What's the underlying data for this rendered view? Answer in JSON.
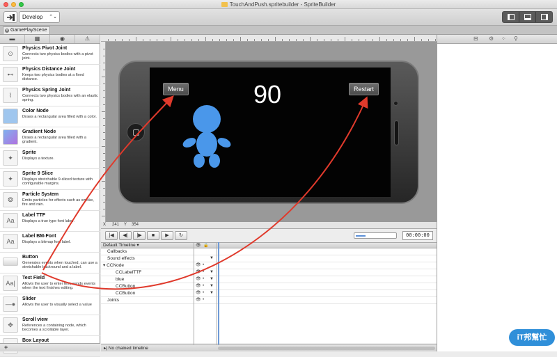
{
  "window": {
    "title": "TouchAndPush.spritebuilder - SpriteBuilder"
  },
  "toolbar": {
    "config": "Develop"
  },
  "tab": {
    "label": "GamePlayScene"
  },
  "library": {
    "items": [
      {
        "name": "Physics Pivot Joint",
        "desc": "Connects two physics bodies with a pivot joint.",
        "icon": "pivot-joint-icon",
        "glyph": "⊙"
      },
      {
        "name": "Physics Distance Joint",
        "desc": "Keeps two physics bodies at a fixed distance.",
        "icon": "distance-joint-icon",
        "glyph": "⊷"
      },
      {
        "name": "Physics Spring Joint",
        "desc": "Connects two physics bodies with an elastic spring.",
        "icon": "spring-joint-icon",
        "glyph": "⌇"
      },
      {
        "name": "Color Node",
        "desc": "Draws a rectangular area filled with a color.",
        "icon": "color-node-icon",
        "glyph": ""
      },
      {
        "name": "Gradient Node",
        "desc": "Draws a rectangular area filled with a gradient.",
        "icon": "gradient-node-icon",
        "glyph": ""
      },
      {
        "name": "Sprite",
        "desc": "Displays a texture.",
        "icon": "sprite-icon",
        "glyph": "✦"
      },
      {
        "name": "Sprite 9 Slice",
        "desc": "Displays stretchable 9-sliced texture with configurable margins.",
        "icon": "sprite-9-slice-icon",
        "glyph": "✦"
      },
      {
        "name": "Particle System",
        "desc": "Emits particles for effects such as smoke, fire and rain.",
        "icon": "particle-system-icon",
        "glyph": "❂"
      },
      {
        "name": "Label TTF",
        "desc": "Displays a true type font label.",
        "icon": "label-ttf-icon",
        "glyph": "Aa"
      },
      {
        "name": "Label BM-Font",
        "desc": "Displays a bitmap font label.",
        "icon": "label-bmfont-icon",
        "glyph": "Aa"
      },
      {
        "name": "Button",
        "desc": "Generates events when touched, can use a stretchable backround and a label.",
        "icon": "button-icon",
        "glyph": ""
      },
      {
        "name": "Text Field",
        "desc": "Allows the user to enter text, sends events when the text finishes editing.",
        "icon": "text-field-icon",
        "glyph": "Aa|"
      },
      {
        "name": "Slider",
        "desc": "Allows the user to visually select a value",
        "icon": "slider-icon",
        "glyph": "—●—"
      },
      {
        "name": "Scroll view",
        "desc": "References a containing node, which becomes a scrollable layer.",
        "icon": "scroll-view-icon",
        "glyph": "✥"
      },
      {
        "name": "Box Layout",
        "desc": "",
        "icon": "box-layout-icon",
        "glyph": "▤"
      }
    ]
  },
  "stage": {
    "menu_label": "Menu",
    "restart_label": "Restart",
    "score": "90",
    "figure_color": "#4a97ea"
  },
  "coords": {
    "x_label": "X",
    "x_value": "241",
    "y_label": "Y",
    "y_value": "354"
  },
  "timeline": {
    "name": "Default Timeline",
    "timecode": "00:00:00",
    "chained": "No chained timeline",
    "rows": [
      {
        "name": "Callbacks",
        "indent": 1,
        "eye": "",
        "lock": "",
        "key": ""
      },
      {
        "name": "Sound effects",
        "indent": 1,
        "eye": "",
        "lock": "",
        "key": "▼"
      },
      {
        "name": "▾ CCNode",
        "indent": 0,
        "eye": "👁",
        "lock": "•",
        "key": ""
      },
      {
        "name": "CCLabelTTF",
        "indent": 3,
        "eye": "👁",
        "lock": "•",
        "key": "▼"
      },
      {
        "name": "blue",
        "indent": 3,
        "eye": "👁",
        "lock": "•",
        "key": "▼"
      },
      {
        "name": "CCButton",
        "indent": 3,
        "eye": "👁",
        "lock": "•",
        "key": "▼"
      },
      {
        "name": "CCButton",
        "indent": 3,
        "eye": "👁",
        "lock": "•",
        "key": "▼"
      },
      {
        "name": "Joints",
        "indent": 1,
        "eye": "👁",
        "lock": "•",
        "key": ""
      }
    ]
  },
  "watermark": "iT邦幫忙",
  "colors": {
    "accent": "#4a97ea",
    "arrow": "#e03a2c"
  }
}
